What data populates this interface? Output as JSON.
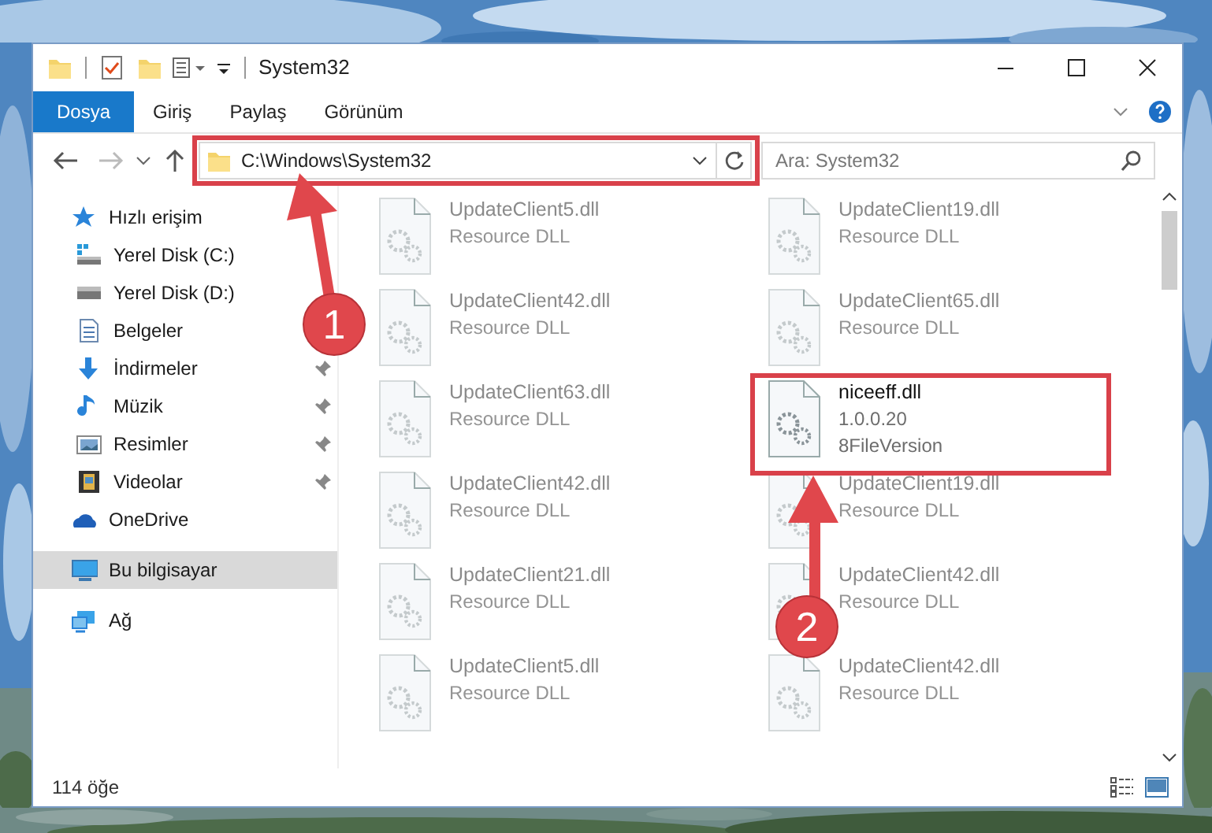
{
  "window": {
    "title": "System32"
  },
  "ribbon_tabs": [
    {
      "label": "Dosya",
      "selected": true
    },
    {
      "label": "Giriş",
      "selected": false
    },
    {
      "label": "Paylaş",
      "selected": false
    },
    {
      "label": "Görünüm",
      "selected": false
    }
  ],
  "address_bar": {
    "path": "C:\\Windows\\System32"
  },
  "search": {
    "placeholder": "Ara: System32"
  },
  "sidebar": {
    "items": [
      {
        "label": "Hızlı erişim",
        "kind": "star",
        "selected": false,
        "children": [
          {
            "label": "Yerel Disk (C:)",
            "kind": "drive-win",
            "pinned": false,
            "selected": false
          },
          {
            "label": "Yerel Disk (D:)",
            "kind": "drive",
            "pinned": false,
            "selected": false
          },
          {
            "label": "Belgeler",
            "kind": "docs",
            "pinned": false,
            "selected": false
          },
          {
            "label": "İndirmeler",
            "kind": "download",
            "pinned": true,
            "selected": false
          },
          {
            "label": "Müzik",
            "kind": "music",
            "pinned": true,
            "selected": false
          },
          {
            "label": "Resimler",
            "kind": "pictures",
            "pinned": true,
            "selected": false
          },
          {
            "label": "Videolar",
            "kind": "videos",
            "pinned": true,
            "selected": false
          }
        ]
      },
      {
        "label": "OneDrive",
        "kind": "cloud",
        "selected": false
      },
      {
        "label": "Bu bilgisayar",
        "kind": "pc",
        "selected": true
      },
      {
        "label": "Ağ",
        "kind": "network",
        "selected": false
      }
    ]
  },
  "files": [
    {
      "name": "UpdateClient5.dll",
      "lines": [
        "Resource DLL"
      ],
      "dimmed": true
    },
    {
      "name": "UpdateClient19.dll",
      "lines": [
        "Resource DLL"
      ],
      "dimmed": true
    },
    {
      "name": "UpdateClient42.dll",
      "lines": [
        "Resource DLL"
      ],
      "dimmed": true
    },
    {
      "name": "UpdateClient65.dll",
      "lines": [
        "Resource DLL"
      ],
      "dimmed": true
    },
    {
      "name": "UpdateClient63.dll",
      "lines": [
        "Resource DLL"
      ],
      "dimmed": true
    },
    {
      "name": "niceeff.dll",
      "lines": [
        "1.0.0.20",
        "8FileVersion"
      ],
      "dimmed": false
    },
    {
      "name": "UpdateClient42.dll",
      "lines": [
        "Resource DLL"
      ],
      "dimmed": true
    },
    {
      "name": "UpdateClient19.dll",
      "lines": [
        "Resource DLL"
      ],
      "dimmed": true
    },
    {
      "name": "UpdateClient21.dll",
      "lines": [
        "Resource DLL"
      ],
      "dimmed": true
    },
    {
      "name": "UpdateClient42.dll",
      "lines": [
        "Resource DLL"
      ],
      "dimmed": true
    },
    {
      "name": "UpdateClient5.dll",
      "lines": [
        "Resource DLL"
      ],
      "dimmed": true
    },
    {
      "name": "UpdateClient42.dll",
      "lines": [
        "Resource DLL"
      ],
      "dimmed": true
    }
  ],
  "status_bar": {
    "count": "114 öğe"
  },
  "annotations": [
    {
      "label": "1"
    },
    {
      "label": "2"
    }
  ]
}
